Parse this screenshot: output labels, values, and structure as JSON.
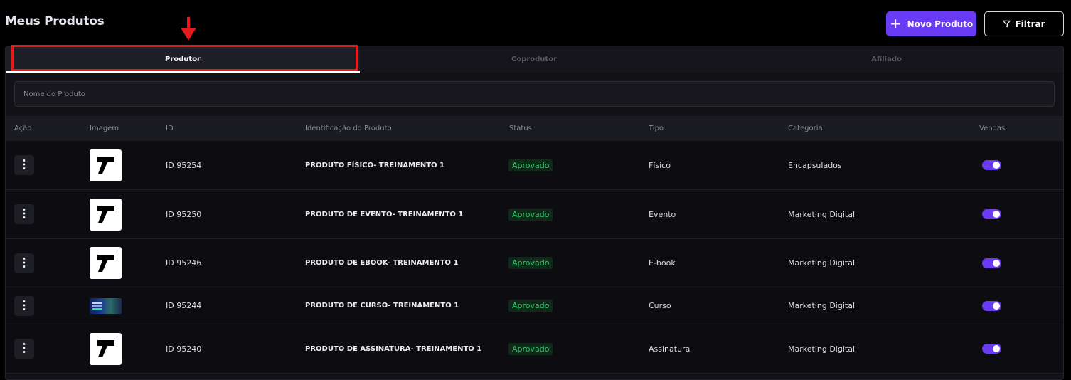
{
  "page": {
    "title": "Meus Produtos"
  },
  "toolbar": {
    "new_product_label": "Novo Produto",
    "filter_label": "Filtrar"
  },
  "tabs": [
    {
      "label": "Produtor",
      "active": true
    },
    {
      "label": "Coprodutor",
      "active": false
    },
    {
      "label": "Afiliado",
      "active": false
    }
  ],
  "search": {
    "placeholder": "Nome do Produto",
    "value": ""
  },
  "table": {
    "columns": [
      "Ação",
      "Imagem",
      "ID",
      "Identificação do Produto",
      "Status",
      "Tipo",
      "Categoria",
      "Vendas"
    ],
    "rows": [
      {
        "image": "logo",
        "id": "ID 95254",
        "name": "PRODUTO FÍSICO- TREINAMENTO 1",
        "status": "Aprovado",
        "tipo": "Físico",
        "categoria": "Encapsulados",
        "vendas": true
      },
      {
        "image": "logo",
        "id": "ID 95250",
        "name": "PRODUTO DE EVENTO- TREINAMENTO 1",
        "status": "Aprovado",
        "tipo": "Evento",
        "categoria": "Marketing Digital",
        "vendas": true
      },
      {
        "image": "logo",
        "id": "ID 95246",
        "name": "PRODUTO DE EBOOK- TREINAMENTO 1",
        "status": "Aprovado",
        "tipo": "E-book",
        "categoria": "Marketing Digital",
        "vendas": true
      },
      {
        "image": "banner",
        "id": "ID 95244",
        "name": "PRODUTO DE CURSO- TREINAMENTO 1",
        "status": "Aprovado",
        "tipo": "Curso",
        "categoria": "Marketing Digital",
        "vendas": true
      },
      {
        "image": "logo",
        "id": "ID 95240",
        "name": "PRODUTO DE ASSINATURA- TREINAMENTO 1",
        "status": "Aprovado",
        "tipo": "Assinatura",
        "categoria": "Marketing Digital",
        "vendas": true
      }
    ]
  },
  "icons": {
    "new_product": "plus-icon",
    "filter": "filter-icon",
    "row_menu": "vertical-dots-icon",
    "annotation": "red-arrow-down-icon"
  },
  "colors": {
    "accent": "#6a3bf5",
    "status_approved": "#2ec86b",
    "annotation": "#e51b1b",
    "background": "#000000"
  }
}
